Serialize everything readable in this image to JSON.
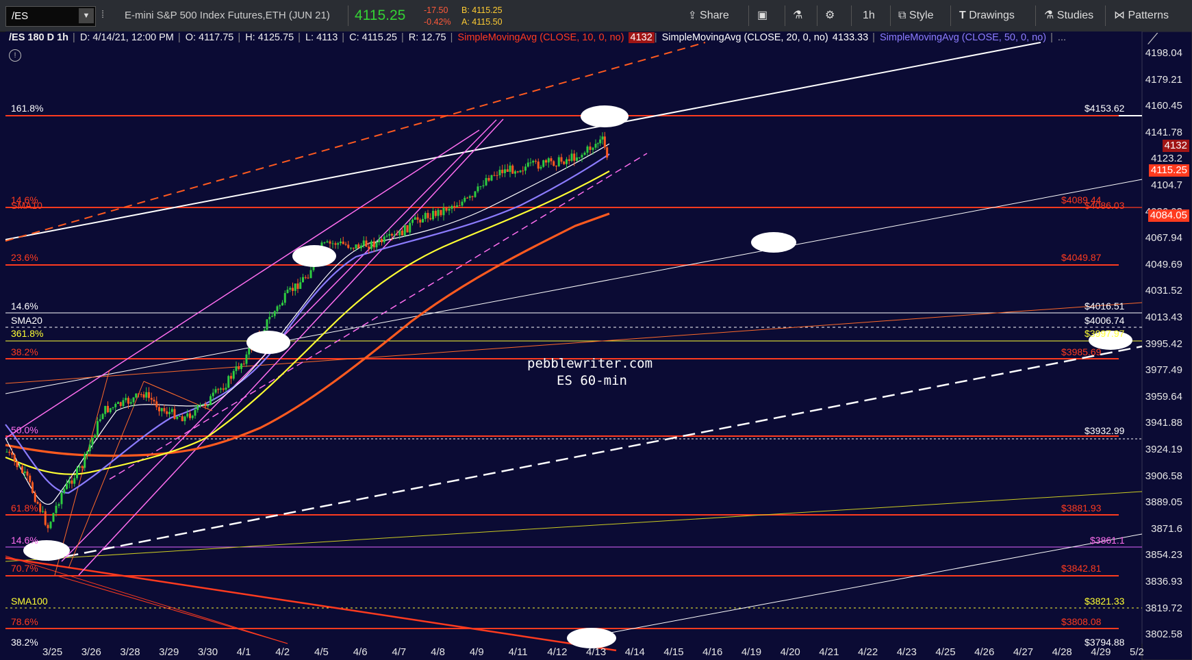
{
  "toolbar": {
    "symbol": "/ES",
    "description": "E-mini S&P 500 Index Futures,ETH (JUN 21)",
    "last": "4115.25",
    "change": "-17.50",
    "change_pct": "-0.42%",
    "bid": "B: 4115.25",
    "ask": "A: 4115.50",
    "share": "Share",
    "timeframe": "1h",
    "style": "Style",
    "drawings": "Drawings",
    "studies": "Studies",
    "patterns": "Patterns"
  },
  "info_bar": {
    "title": "/ES 180 D 1h",
    "date": "D: 4/14/21, 12:00 PM",
    "open": "O: 4117.75",
    "high": "H: 4125.75",
    "low": "L: 4113",
    "close": "C: 4115.25",
    "range": "R: 12.75",
    "sma10": "SimpleMovingAvg (CLOSE, 10, 0, no)",
    "sma10_val": "4132",
    "sma20": "SimpleMovingAvg (CLOSE, 20, 0, no)",
    "sma20_val": "4133.33",
    "sma50": "SimpleMovingAvg (CLOSE, 50, 0, no)",
    "more": "..."
  },
  "y_axis": [
    "4198.04",
    "4179.21",
    "4160.45",
    "4141.78",
    "4123.2",
    "4104.7",
    "4086.03",
    "4067.94",
    "4049.69",
    "4031.52",
    "4013.43",
    "3995.42",
    "3977.49",
    "3959.64",
    "3941.88",
    "3924.19",
    "3906.58",
    "3889.05",
    "3871.6",
    "3854.23",
    "3836.93",
    "3819.72",
    "3802.58"
  ],
  "x_axis": [
    "3/25",
    "3/26",
    "3/28",
    "3/29",
    "3/30",
    "4/1",
    "4/2",
    "4/5",
    "4/6",
    "4/7",
    "4/8",
    "4/9",
    "4/11",
    "4/12",
    "4/13",
    "4/14",
    "4/15",
    "4/16",
    "4/19",
    "4/20",
    "4/21",
    "4/22",
    "4/23",
    "4/25",
    "4/26",
    "4/27",
    "4/28",
    "4/29",
    "5/2"
  ],
  "levels_left": {
    "l1": "161.8%",
    "l2": "14.6%",
    "l3": "SMA10",
    "l4": "23.6%",
    "l5": "14.6%",
    "l6": "SMA20",
    "l7": "361.8%",
    "l8": "38.2%",
    "l9": "50.0%",
    "l10": "61.8%",
    "l11": "14.6%",
    "l12": "70.7%",
    "l13": "SMA100",
    "l14": "78.6%",
    "l15": "38.2%"
  },
  "levels_right": {
    "r1": "$4153.62",
    "r2": "$4089.44",
    "r3": "$4086.03",
    "r4": "$4049.87",
    "r5": "$4016.51",
    "r6": "$4006.74",
    "r7": "$3997.97",
    "r8": "$3985.69",
    "r9": "$3932.99",
    "r10": "$3881.93",
    "r11": "$3861.1",
    "r12": "$3842.81",
    "r13": "$3821.33",
    "r14": "$3808.08",
    "r15": "$3794.88"
  },
  "tags": {
    "sma": "4132",
    "last": "4115.25",
    "sma10": "4084.05"
  },
  "watermark": {
    "line1": "pebblewriter.com",
    "line2": "ES  60-min"
  },
  "colors": {
    "background": "#0b0b34",
    "fib": "#ff3b1f",
    "sma10": "#ff5a1f",
    "sma20": "#ffff33",
    "sma50": "#8c7cff",
    "channel": "#ff6ef0",
    "up": "#2ecc40",
    "down": "#ff5a1f"
  }
}
